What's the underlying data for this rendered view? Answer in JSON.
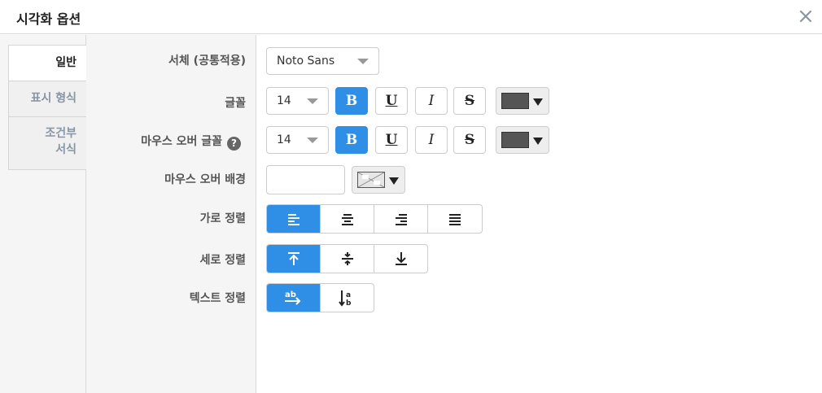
{
  "title": "시각화 옵션",
  "tabs": [
    {
      "label": "일반"
    },
    {
      "label": "표시 형식"
    },
    {
      "label": "조건부\n서식"
    }
  ],
  "labels": {
    "font_family": "서체 (공통적용)",
    "font": "글꼴",
    "hover_font": "마우스 오버 글꼴",
    "hover_bg": "마우스 오버 배경",
    "h_align": "가로 정렬",
    "v_align": "세로 정렬",
    "text_align": "텍스트 정렬"
  },
  "font_family": {
    "value": "Noto Sans"
  },
  "font": {
    "size": "14",
    "bold": "B",
    "underline": "U",
    "italic": "I",
    "strike": "S",
    "bold_active": true,
    "color": "#555555"
  },
  "hover_font": {
    "size": "14",
    "bold": "B",
    "underline": "U",
    "italic": "I",
    "strike": "S",
    "bold_active": true,
    "color": "#555555"
  },
  "icons": {
    "close": "close-icon",
    "help": "question-circle-icon"
  },
  "help_glyph": "?",
  "accent": "#2f8ee6"
}
